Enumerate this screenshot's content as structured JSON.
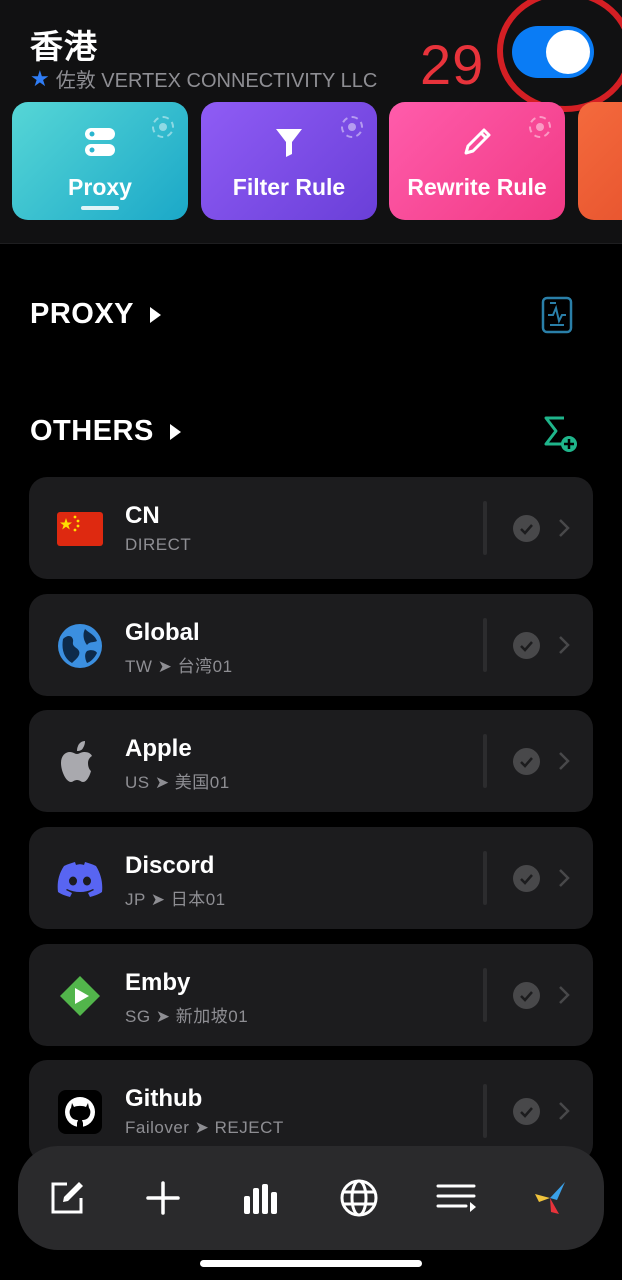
{
  "header": {
    "title": "香港",
    "subtitle": "佐敦 VERTEX CONNECTIVITY LLC",
    "annotation_number": "29",
    "toggle_on": true
  },
  "tabs": [
    {
      "label": "Proxy",
      "icon": "server-icon",
      "selected": true
    },
    {
      "label": "Filter Rule",
      "icon": "funnel-icon",
      "selected": false
    },
    {
      "label": "Rewrite Rule",
      "icon": "pencil-icon",
      "selected": false
    }
  ],
  "sections": {
    "proxy": "PROXY",
    "others": "OTHERS"
  },
  "policies": [
    {
      "name": "CN",
      "detail": "DIRECT",
      "icon": "china-flag-icon"
    },
    {
      "name": "Global",
      "detail": "TW ➤ 台湾01",
      "icon": "globe-icon"
    },
    {
      "name": "Apple",
      "detail": "US ➤ 美国01",
      "icon": "apple-logo-icon"
    },
    {
      "name": "Discord",
      "detail": "JP ➤ 日本01",
      "icon": "discord-logo-icon"
    },
    {
      "name": "Emby",
      "detail": "SG ➤ 新加坡01",
      "icon": "emby-logo-icon"
    },
    {
      "name": "Github",
      "detail": "Failover ➤ REJECT",
      "icon": "github-logo-icon"
    }
  ],
  "toolbar": [
    "edit-icon",
    "plus-icon",
    "bar-chart-icon",
    "globe-icon",
    "list-icon",
    "app-logo-icon"
  ],
  "colors": {
    "accent": "#0a7cf5",
    "annotation": "#e8333b",
    "proxy_tab": "#1ba8c8",
    "filter_tab": "#6a3fd8",
    "rewrite_tab": "#f13a85"
  }
}
